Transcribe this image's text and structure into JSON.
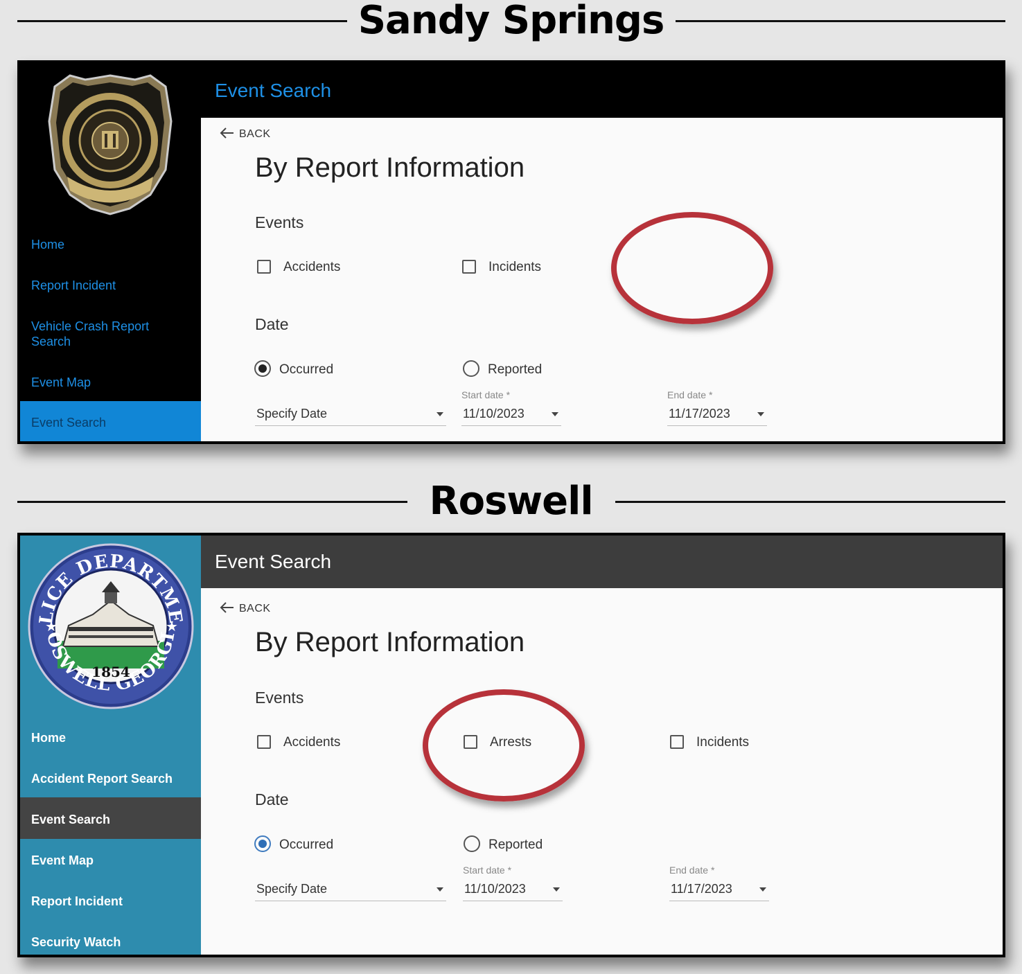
{
  "sections": [
    {
      "title": "Sandy Springs",
      "app_title": "Event Search",
      "nav": [
        "Home",
        "Report Incident",
        "Vehicle Crash Report Search",
        "Event Map",
        "Event Search"
      ],
      "back": "BACK",
      "heading": "By Report Information",
      "events_label": "Events",
      "events": [
        "Accidents",
        "Incidents"
      ],
      "date_label": "Date",
      "date_options": [
        "Occurred",
        "Reported"
      ],
      "selected_date_option": "Occurred",
      "date_mode": "Specify Date",
      "start_date_label": "Start date *",
      "start_date": "11/10/2023",
      "end_date_label": "End date *",
      "end_date": "11/17/2023",
      "logo_icon": "sandy-springs-police-badge-icon"
    },
    {
      "title": "Roswell",
      "app_title": "Event Search",
      "nav": [
        "Home",
        "Accident Report Search",
        "Event Search",
        "Event Map",
        "Report Incident",
        "Security Watch"
      ],
      "back": "BACK",
      "heading": "By Report Information",
      "events_label": "Events",
      "events": [
        "Accidents",
        "Arrests",
        "Incidents"
      ],
      "date_label": "Date",
      "date_options": [
        "Occurred",
        "Reported"
      ],
      "selected_date_option": "Occurred",
      "date_mode": "Specify Date",
      "start_date_label": "Start date *",
      "start_date": "11/10/2023",
      "end_date_label": "End date *",
      "end_date": "11/17/2023",
      "logo_icon": "roswell-police-department-seal-icon",
      "seal_text": {
        "top": "POLICE DEPARTMENT",
        "bottom": "ROSWELL GEORGIA",
        "year": "1854"
      }
    }
  ],
  "colors": {
    "highlight_circle": "#b7323a",
    "sandy_nav_link": "#1e90e6",
    "roswell_sidebar": "#2e8cae"
  }
}
